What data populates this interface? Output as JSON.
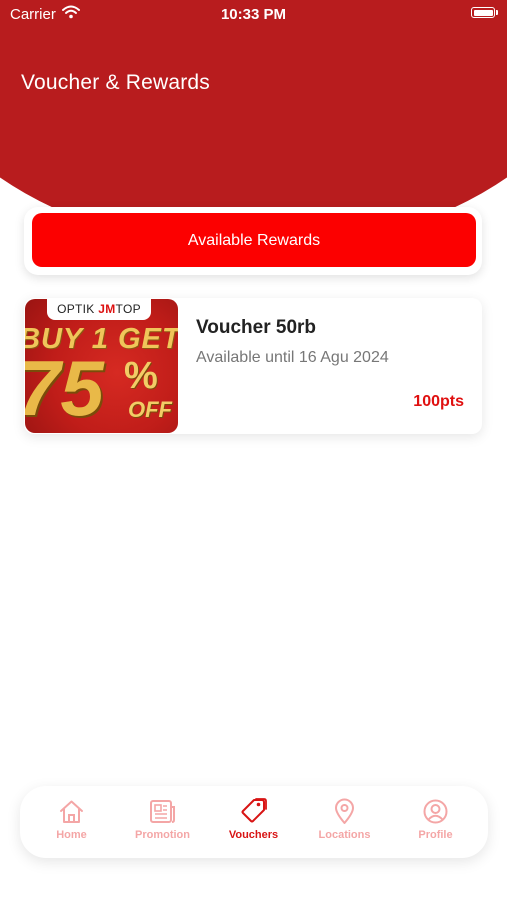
{
  "status_bar": {
    "carrier": "Carrier",
    "time": "10:33 PM"
  },
  "header": {
    "title": "Voucher & Rewards"
  },
  "rewards_button": {
    "label": "Available Rewards"
  },
  "vouchers": [
    {
      "image": {
        "logo_prefix": "OPTIK",
        "logo_brand_jm": "JM",
        "logo_brand_top": "TOP",
        "line1": "BUY 1 GET",
        "number": "75",
        "percent": "%",
        "off": "OFF"
      },
      "title": "Voucher 50rb",
      "validity": "Available until 16 Agu 2024",
      "points": "100pts"
    }
  ],
  "tabbar": {
    "tabs": [
      {
        "label": "Home",
        "icon": "home-icon"
      },
      {
        "label": "Promotion",
        "icon": "newspaper-icon"
      },
      {
        "label": "Vouchers",
        "icon": "tag-icon",
        "active": true
      },
      {
        "label": "Locations",
        "icon": "location-pin-icon"
      },
      {
        "label": "Profile",
        "icon": "user-circle-icon"
      }
    ]
  },
  "colors": {
    "header": "#b81c1e",
    "accent": "#fc0000",
    "points": "#e01010",
    "tab_active": "#d81414",
    "tab_inactive": "#f4a6a6"
  }
}
